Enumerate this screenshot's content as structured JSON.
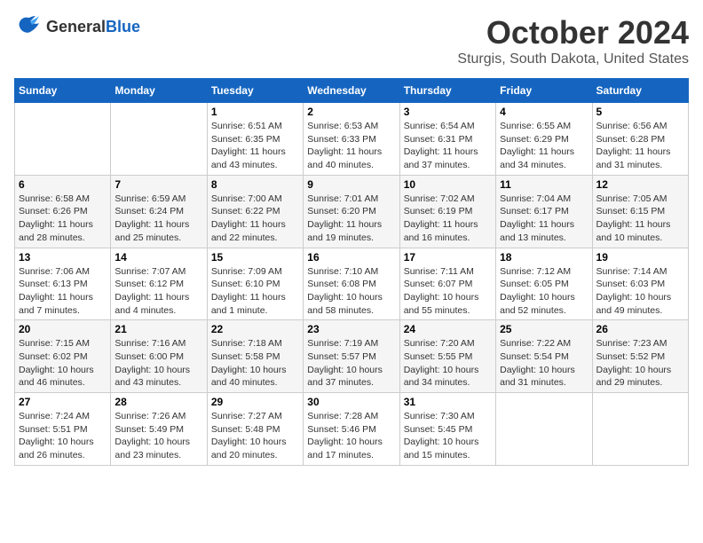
{
  "header": {
    "logo": {
      "general": "General",
      "blue": "Blue"
    },
    "month": "October 2024",
    "location": "Sturgis, South Dakota, United States"
  },
  "weekdays": [
    "Sunday",
    "Monday",
    "Tuesday",
    "Wednesday",
    "Thursday",
    "Friday",
    "Saturday"
  ],
  "weeks": [
    [
      {
        "day": "",
        "sunrise": "",
        "sunset": "",
        "daylight": ""
      },
      {
        "day": "",
        "sunrise": "",
        "sunset": "",
        "daylight": ""
      },
      {
        "day": "1",
        "sunrise": "Sunrise: 6:51 AM",
        "sunset": "Sunset: 6:35 PM",
        "daylight": "Daylight: 11 hours and 43 minutes."
      },
      {
        "day": "2",
        "sunrise": "Sunrise: 6:53 AM",
        "sunset": "Sunset: 6:33 PM",
        "daylight": "Daylight: 11 hours and 40 minutes."
      },
      {
        "day": "3",
        "sunrise": "Sunrise: 6:54 AM",
        "sunset": "Sunset: 6:31 PM",
        "daylight": "Daylight: 11 hours and 37 minutes."
      },
      {
        "day": "4",
        "sunrise": "Sunrise: 6:55 AM",
        "sunset": "Sunset: 6:29 PM",
        "daylight": "Daylight: 11 hours and 34 minutes."
      },
      {
        "day": "5",
        "sunrise": "Sunrise: 6:56 AM",
        "sunset": "Sunset: 6:28 PM",
        "daylight": "Daylight: 11 hours and 31 minutes."
      }
    ],
    [
      {
        "day": "6",
        "sunrise": "Sunrise: 6:58 AM",
        "sunset": "Sunset: 6:26 PM",
        "daylight": "Daylight: 11 hours and 28 minutes."
      },
      {
        "day": "7",
        "sunrise": "Sunrise: 6:59 AM",
        "sunset": "Sunset: 6:24 PM",
        "daylight": "Daylight: 11 hours and 25 minutes."
      },
      {
        "day": "8",
        "sunrise": "Sunrise: 7:00 AM",
        "sunset": "Sunset: 6:22 PM",
        "daylight": "Daylight: 11 hours and 22 minutes."
      },
      {
        "day": "9",
        "sunrise": "Sunrise: 7:01 AM",
        "sunset": "Sunset: 6:20 PM",
        "daylight": "Daylight: 11 hours and 19 minutes."
      },
      {
        "day": "10",
        "sunrise": "Sunrise: 7:02 AM",
        "sunset": "Sunset: 6:19 PM",
        "daylight": "Daylight: 11 hours and 16 minutes."
      },
      {
        "day": "11",
        "sunrise": "Sunrise: 7:04 AM",
        "sunset": "Sunset: 6:17 PM",
        "daylight": "Daylight: 11 hours and 13 minutes."
      },
      {
        "day": "12",
        "sunrise": "Sunrise: 7:05 AM",
        "sunset": "Sunset: 6:15 PM",
        "daylight": "Daylight: 11 hours and 10 minutes."
      }
    ],
    [
      {
        "day": "13",
        "sunrise": "Sunrise: 7:06 AM",
        "sunset": "Sunset: 6:13 PM",
        "daylight": "Daylight: 11 hours and 7 minutes."
      },
      {
        "day": "14",
        "sunrise": "Sunrise: 7:07 AM",
        "sunset": "Sunset: 6:12 PM",
        "daylight": "Daylight: 11 hours and 4 minutes."
      },
      {
        "day": "15",
        "sunrise": "Sunrise: 7:09 AM",
        "sunset": "Sunset: 6:10 PM",
        "daylight": "Daylight: 11 hours and 1 minute."
      },
      {
        "day": "16",
        "sunrise": "Sunrise: 7:10 AM",
        "sunset": "Sunset: 6:08 PM",
        "daylight": "Daylight: 10 hours and 58 minutes."
      },
      {
        "day": "17",
        "sunrise": "Sunrise: 7:11 AM",
        "sunset": "Sunset: 6:07 PM",
        "daylight": "Daylight: 10 hours and 55 minutes."
      },
      {
        "day": "18",
        "sunrise": "Sunrise: 7:12 AM",
        "sunset": "Sunset: 6:05 PM",
        "daylight": "Daylight: 10 hours and 52 minutes."
      },
      {
        "day": "19",
        "sunrise": "Sunrise: 7:14 AM",
        "sunset": "Sunset: 6:03 PM",
        "daylight": "Daylight: 10 hours and 49 minutes."
      }
    ],
    [
      {
        "day": "20",
        "sunrise": "Sunrise: 7:15 AM",
        "sunset": "Sunset: 6:02 PM",
        "daylight": "Daylight: 10 hours and 46 minutes."
      },
      {
        "day": "21",
        "sunrise": "Sunrise: 7:16 AM",
        "sunset": "Sunset: 6:00 PM",
        "daylight": "Daylight: 10 hours and 43 minutes."
      },
      {
        "day": "22",
        "sunrise": "Sunrise: 7:18 AM",
        "sunset": "Sunset: 5:58 PM",
        "daylight": "Daylight: 10 hours and 40 minutes."
      },
      {
        "day": "23",
        "sunrise": "Sunrise: 7:19 AM",
        "sunset": "Sunset: 5:57 PM",
        "daylight": "Daylight: 10 hours and 37 minutes."
      },
      {
        "day": "24",
        "sunrise": "Sunrise: 7:20 AM",
        "sunset": "Sunset: 5:55 PM",
        "daylight": "Daylight: 10 hours and 34 minutes."
      },
      {
        "day": "25",
        "sunrise": "Sunrise: 7:22 AM",
        "sunset": "Sunset: 5:54 PM",
        "daylight": "Daylight: 10 hours and 31 minutes."
      },
      {
        "day": "26",
        "sunrise": "Sunrise: 7:23 AM",
        "sunset": "Sunset: 5:52 PM",
        "daylight": "Daylight: 10 hours and 29 minutes."
      }
    ],
    [
      {
        "day": "27",
        "sunrise": "Sunrise: 7:24 AM",
        "sunset": "Sunset: 5:51 PM",
        "daylight": "Daylight: 10 hours and 26 minutes."
      },
      {
        "day": "28",
        "sunrise": "Sunrise: 7:26 AM",
        "sunset": "Sunset: 5:49 PM",
        "daylight": "Daylight: 10 hours and 23 minutes."
      },
      {
        "day": "29",
        "sunrise": "Sunrise: 7:27 AM",
        "sunset": "Sunset: 5:48 PM",
        "daylight": "Daylight: 10 hours and 20 minutes."
      },
      {
        "day": "30",
        "sunrise": "Sunrise: 7:28 AM",
        "sunset": "Sunset: 5:46 PM",
        "daylight": "Daylight: 10 hours and 17 minutes."
      },
      {
        "day": "31",
        "sunrise": "Sunrise: 7:30 AM",
        "sunset": "Sunset: 5:45 PM",
        "daylight": "Daylight: 10 hours and 15 minutes."
      },
      {
        "day": "",
        "sunrise": "",
        "sunset": "",
        "daylight": ""
      },
      {
        "day": "",
        "sunrise": "",
        "sunset": "",
        "daylight": ""
      }
    ]
  ]
}
